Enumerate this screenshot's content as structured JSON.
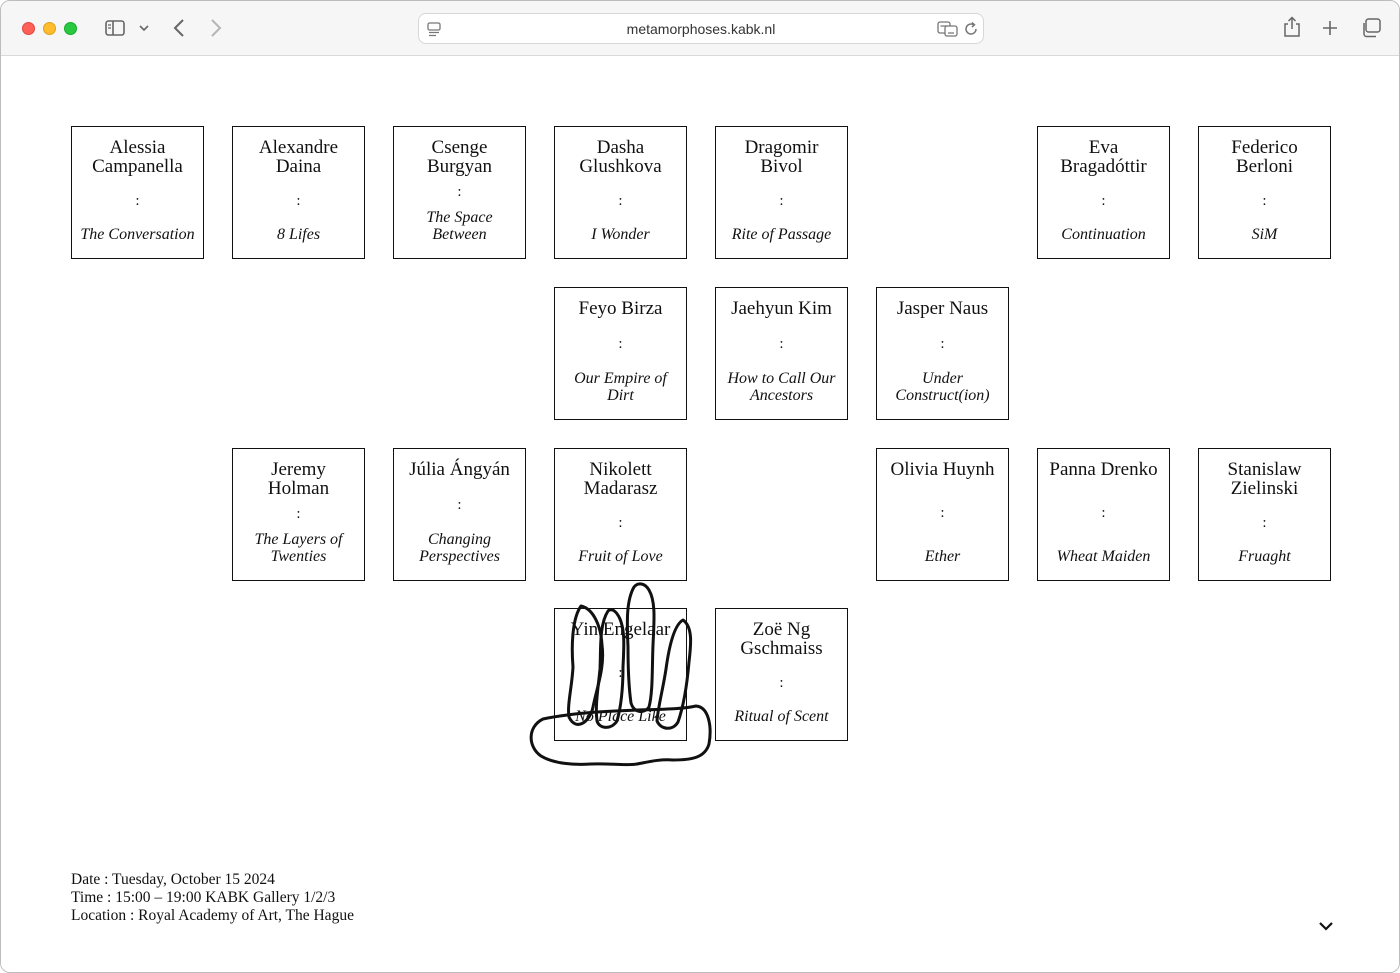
{
  "browser": {
    "url": "metamorphoses.kabk.nl",
    "icons": [
      "sidebar-icon",
      "chevron-down-icon",
      "back-icon",
      "forward-icon",
      "page-menu-icon",
      "translate-icon",
      "reload-icon",
      "share-icon",
      "new-tab-icon",
      "tab-overview-icon"
    ]
  },
  "colors": {
    "close": "#fe5f57",
    "minimize": "#febc2e",
    "zoom": "#28c840",
    "ink": "#111111"
  },
  "cards": [
    {
      "name": "Alessia Campanella",
      "sep": ":",
      "work": "The Conversation"
    },
    {
      "name": "Alexandre Daina",
      "sep": ":",
      "work": "8 Lifes"
    },
    {
      "name": "Csenge Burgyan",
      "sep": ":",
      "work": "The Space Between"
    },
    {
      "name": "Dasha Glushkova",
      "sep": ":",
      "work": "I Wonder"
    },
    {
      "name": "Dragomir Bivol",
      "sep": ":",
      "work": "Rite of Passage"
    },
    {
      "name": "Eva Bragadóttir",
      "sep": ":",
      "work": "Continuation"
    },
    {
      "name": "Federico Berloni",
      "sep": ":",
      "work": "SiM"
    },
    {
      "name": "Feyo Birza",
      "sep": ":",
      "work": "Our Empire of Dirt"
    },
    {
      "name": "Jaehyun Kim",
      "sep": ":",
      "work": "How to Call Our Ancestors"
    },
    {
      "name": "Jasper Naus",
      "sep": ":",
      "work": "Under Construct(ion)"
    },
    {
      "name": "Jeremy Holman",
      "sep": ":",
      "work": "The Layers of Twenties"
    },
    {
      "name": "Júlia Ángyán",
      "sep": ":",
      "work": "Changing Perspectives"
    },
    {
      "name": "Nikolett Madarasz",
      "sep": ":",
      "work": "Fruit of Love"
    },
    {
      "name": "Olivia Huynh",
      "sep": ":",
      "work": "Ether"
    },
    {
      "name": "Panna Drenko",
      "sep": ":",
      "work": "Wheat Maiden"
    },
    {
      "name": "Stanislaw Zielinski",
      "sep": ":",
      "work": "Fruaght"
    },
    {
      "name": "Yin Engelaar",
      "sep": ":",
      "work": "No Place Like"
    },
    {
      "name": "Zoë Ng Gschmaiss",
      "sep": ":",
      "work": "Ritual of Scent"
    }
  ],
  "event": {
    "date": "Date : Tuesday, October 15 2024",
    "time": "Time : 15:00 – 19:00 KABK Gallery 1/2/3",
    "location": "Location : Royal Academy of Art, The Hague"
  },
  "scroll_icon": "chevron-down-icon"
}
